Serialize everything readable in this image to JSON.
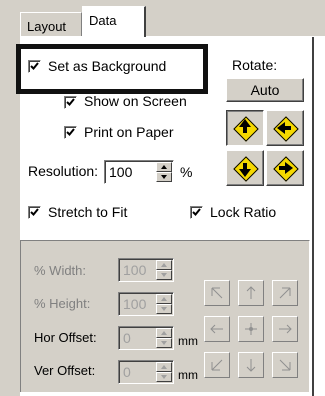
{
  "tabs": [
    {
      "label": "Layout",
      "active": false
    },
    {
      "label": "Data",
      "active": true
    }
  ],
  "options": {
    "set_as_background": {
      "label": "Set as Background",
      "checked": true
    },
    "show_on_screen": {
      "label": "Show on Screen",
      "checked": true
    },
    "print_on_paper": {
      "label": "Print on Paper",
      "checked": true
    },
    "stretch_to_fit": {
      "label": "Stretch to Fit",
      "checked": true
    },
    "lock_ratio": {
      "label": "Lock Ratio",
      "checked": true
    }
  },
  "rotate": {
    "label": "Rotate:",
    "auto_label": "Auto",
    "buttons": [
      "rotate-up-icon",
      "rotate-left-icon",
      "rotate-down-icon",
      "rotate-right-icon"
    ],
    "accent_color": "#f5d800"
  },
  "resolution": {
    "label": "Resolution:",
    "value": "100",
    "unit": "%"
  },
  "size": {
    "width": {
      "label": "% Width:",
      "value": "100"
    },
    "height": {
      "label": "% Height:",
      "value": "100"
    },
    "hor_offset": {
      "label": "Hor Offset:",
      "value": "0",
      "unit": "mm"
    },
    "ver_offset": {
      "label": "Ver Offset:",
      "value": "0",
      "unit": "mm"
    }
  },
  "alignment_grid": [
    "arrow-nw-icon",
    "arrow-n-icon",
    "arrow-ne-icon",
    "arrow-w-icon",
    "center-icon",
    "arrow-e-icon",
    "arrow-sw-icon",
    "arrow-s-icon",
    "arrow-se-icon"
  ]
}
